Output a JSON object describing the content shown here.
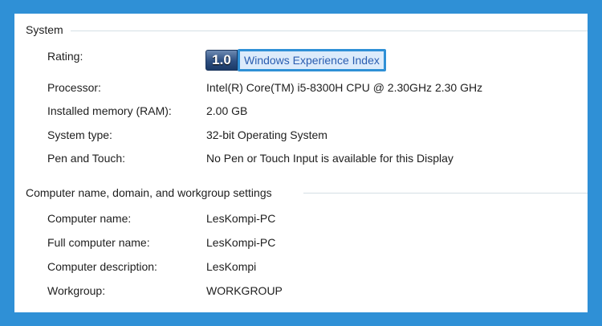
{
  "system": {
    "header": "System",
    "rating_label": "Rating:",
    "rating_score": "1.0",
    "rating_link": "Windows Experience Index",
    "rows": [
      {
        "label": "Processor:",
        "value": "Intel(R) Core(TM) i5-8300H CPU @ 2.30GHz   2.30 GHz"
      },
      {
        "label": "Installed memory (RAM):",
        "value": "2.00 GB"
      },
      {
        "label": "System type:",
        "value": "32-bit Operating System"
      },
      {
        "label": "Pen and Touch:",
        "value": "No Pen or Touch Input is available for this Display"
      }
    ]
  },
  "computer": {
    "header": "Computer name, domain, and workgroup settings",
    "rows": [
      {
        "label": "Computer name:",
        "value": "LesKompi-PC"
      },
      {
        "label": "Full computer name:",
        "value": "LesKompi-PC"
      },
      {
        "label": "Computer description:",
        "value": "LesKompi"
      },
      {
        "label": "Workgroup:",
        "value": "WORKGROUP"
      }
    ]
  },
  "colors": {
    "frame": "#2f90d6",
    "link": "#2a5db0",
    "link_background": "#dcebfb"
  }
}
